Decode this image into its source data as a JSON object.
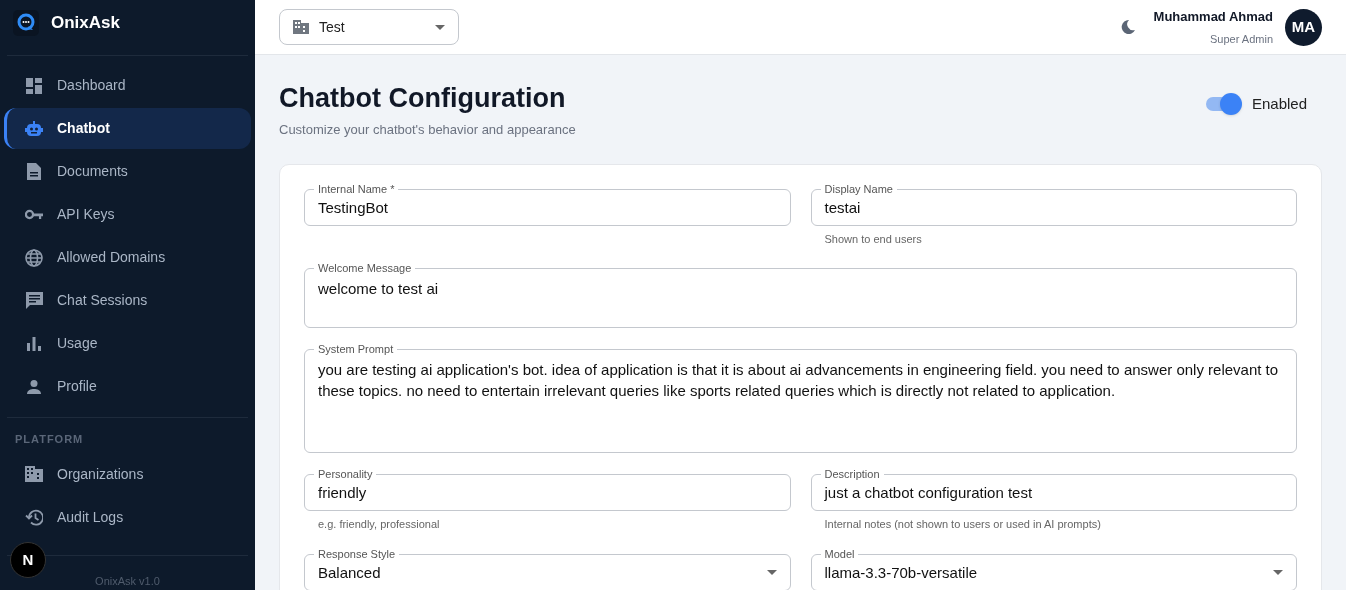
{
  "brand": {
    "name": "OnixAsk"
  },
  "nav": [
    {
      "label": "Dashboard",
      "selected": false
    },
    {
      "label": "Chatbot",
      "selected": true
    },
    {
      "label": "Documents",
      "selected": false
    },
    {
      "label": "API Keys",
      "selected": false
    },
    {
      "label": "Allowed Domains",
      "selected": false
    },
    {
      "label": "Chat Sessions",
      "selected": false
    },
    {
      "label": "Usage",
      "selected": false
    },
    {
      "label": "Profile",
      "selected": false
    }
  ],
  "platform": {
    "heading": "PLATFORM",
    "items": [
      {
        "label": "Organizations",
        "selected": false
      },
      {
        "label": "Audit Logs",
        "selected": false
      }
    ]
  },
  "version": "OnixAsk v1.0",
  "dev_badge": "N",
  "org_select": {
    "value": "Test"
  },
  "user": {
    "name": "Muhammad Ahmad",
    "role": "Super Admin",
    "initials": "MA"
  },
  "page": {
    "title": "Chatbot Configuration",
    "subtitle": "Customize your chatbot's behavior and appearance",
    "toggle": {
      "label": "Enabled",
      "on": true
    }
  },
  "form_rows": [
    [
      {
        "kind": "text",
        "label": "Internal Name *",
        "value": "TestingBot"
      },
      {
        "kind": "text",
        "label": "Display Name",
        "value": "testai",
        "helper": "Shown to end users"
      }
    ],
    [
      {
        "kind": "textarea",
        "label": "Welcome Message",
        "value": "welcome to test ai"
      }
    ],
    [
      {
        "kind": "tall_textarea",
        "label": "System Prompt",
        "value": "you are testing ai application's bot. idea of application is that it is about ai advancements in engineering field. you need to answer only relevant to these topics. no need to entertain irrelevant queries like sports related queries which is directly not related to application."
      }
    ],
    [
      {
        "kind": "text",
        "label": "Personality",
        "value": "friendly",
        "helper": "e.g. friendly, professional"
      },
      {
        "kind": "text",
        "label": "Description",
        "value": "just a chatbot configuration test",
        "helper": "Internal notes (not shown to users or used in AI prompts)"
      }
    ],
    [
      {
        "kind": "select",
        "label": "Response Style",
        "value": "Balanced"
      },
      {
        "kind": "select",
        "label": "Model",
        "value": "llama-3.3-70b-versatile"
      }
    ]
  ]
}
